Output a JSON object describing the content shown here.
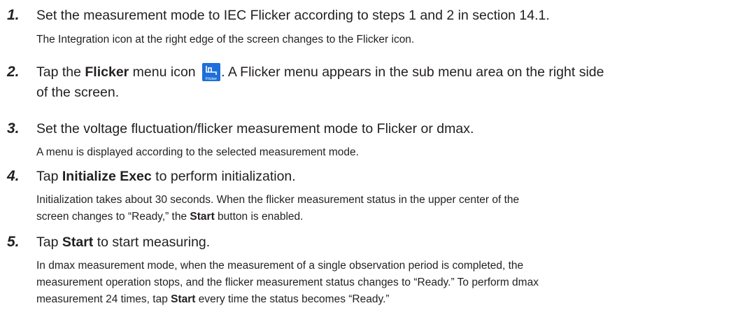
{
  "steps": [
    {
      "number": "1.",
      "main": "Set the measurement mode to IEC Flicker according to steps 1 and 2 in section 14.1.",
      "desc": "The Integration icon at the right edge of the screen changes to the Flicker icon."
    },
    {
      "number": "2.",
      "main_prefix": "Tap the ",
      "main_bold": "Flicker",
      "main_mid": " menu icon",
      "main_suffix": ". A Flicker menu appears in the sub menu area on the right side",
      "main_line2": "of the screen.",
      "icon": "flicker-menu-icon",
      "icon_caption": "Flicker"
    },
    {
      "number": "3.",
      "main": "Set the voltage fluctuation/flicker measurement mode to Flicker or dmax.",
      "desc": "A menu is displayed according to the selected measurement mode."
    },
    {
      "number": "4.",
      "main_prefix": "Tap ",
      "main_bold": "Initialize Exec",
      "main_suffix": " to perform initialization.",
      "desc_line1": "Initialization takes about 30 seconds. When the flicker measurement status in the upper center of the",
      "desc_line2_prefix": "screen changes to “Ready,” the ",
      "desc_line2_bold": "Start",
      "desc_line2_suffix": " button is enabled."
    },
    {
      "number": "5.",
      "main_prefix": "Tap ",
      "main_bold": "Start",
      "main_suffix": " to start measuring.",
      "desc_line1": "In dmax measurement mode, when the measurement of a single observation period is completed, the",
      "desc_line2": "measurement operation stops, and the flicker measurement status changes to “Ready.” To perform dmax",
      "desc_line3_prefix": "measurement 24 times, tap ",
      "desc_line3_bold": "Start",
      "desc_line3_suffix": " every time the status becomes “Ready.”"
    }
  ],
  "colors": {
    "text": "#231f20",
    "icon_bg": "#1e6fd9"
  }
}
